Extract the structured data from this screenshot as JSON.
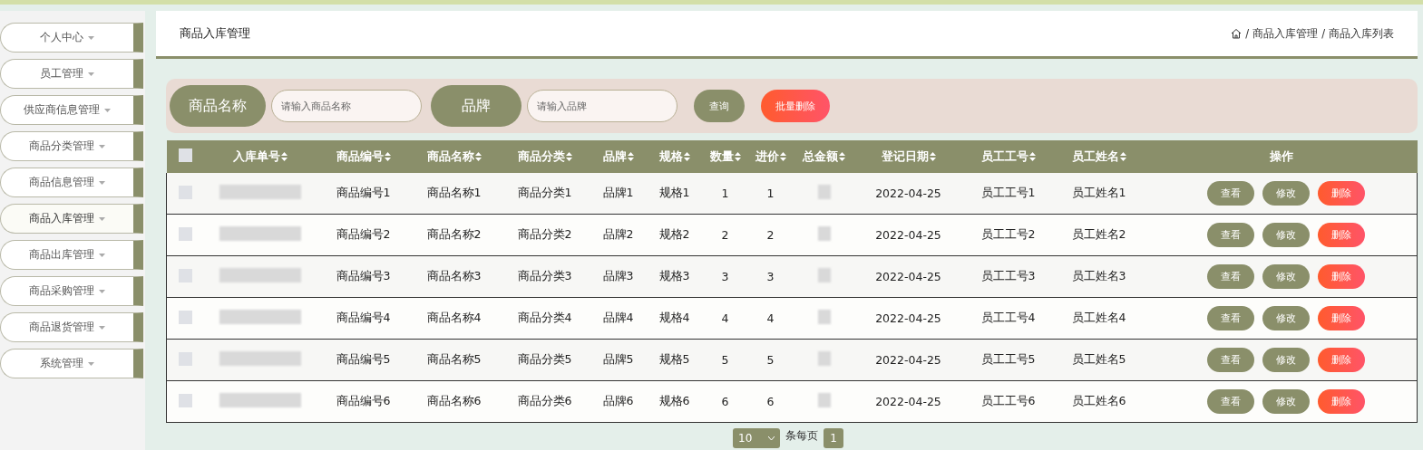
{
  "sidebar": {
    "items": [
      {
        "label": "个人中心",
        "selected": false
      },
      {
        "label": "员工管理",
        "selected": false
      },
      {
        "label": "供应商信息管理",
        "selected": false
      },
      {
        "label": "商品分类管理",
        "selected": false
      },
      {
        "label": "商品信息管理",
        "selected": false
      },
      {
        "label": "商品入库管理",
        "selected": true
      },
      {
        "label": "商品出库管理",
        "selected": false
      },
      {
        "label": "商品采购管理",
        "selected": false
      },
      {
        "label": "商品退货管理",
        "selected": false
      },
      {
        "label": "系统管理",
        "selected": false
      }
    ]
  },
  "header": {
    "title": "商品入库管理",
    "breadcrumb": [
      {
        "separator": "/",
        "label": "商品入库管理"
      },
      {
        "separator": "/",
        "label": "商品入库列表"
      }
    ]
  },
  "search": {
    "fields": [
      {
        "label": "商品名称",
        "placeholder": "请输入商品名称"
      },
      {
        "label": "品牌",
        "placeholder": "请输入品牌"
      }
    ],
    "query_button": "查询",
    "batch_delete_button": "批量删除"
  },
  "table": {
    "select_all_checked": false,
    "columns": [
      "入库单号",
      "商品编号",
      "商品名称",
      "商品分类",
      "品牌",
      "规格",
      "数量",
      "进价",
      "总金额",
      "登记日期",
      "员工工号",
      "员工姓名",
      "操作"
    ],
    "rows": [
      {
        "checked": false,
        "cells": [
          "",
          "商品编号1",
          "商品名称1",
          "商品分类1",
          "品牌1",
          "规格1",
          "1",
          "1",
          "",
          "2022-04-25",
          "员工工号1",
          "员工姓名1"
        ],
        "actions": [
          {
            "label": "查看",
            "kind": "neutral"
          },
          {
            "label": "修改",
            "kind": "neutral"
          },
          {
            "label": "删除",
            "kind": "danger"
          }
        ]
      },
      {
        "checked": false,
        "cells": [
          "",
          "商品编号2",
          "商品名称2",
          "商品分类2",
          "品牌2",
          "规格2",
          "2",
          "2",
          "",
          "2022-04-25",
          "员工工号2",
          "员工姓名2"
        ],
        "actions": [
          {
            "label": "查看",
            "kind": "neutral"
          },
          {
            "label": "修改",
            "kind": "neutral"
          },
          {
            "label": "删除",
            "kind": "danger"
          }
        ]
      },
      {
        "checked": false,
        "cells": [
          "",
          "商品编号3",
          "商品名称3",
          "商品分类3",
          "品牌3",
          "规格3",
          "3",
          "3",
          "",
          "2022-04-25",
          "员工工号3",
          "员工姓名3"
        ],
        "actions": [
          {
            "label": "查看",
            "kind": "neutral"
          },
          {
            "label": "修改",
            "kind": "neutral"
          },
          {
            "label": "删除",
            "kind": "danger"
          }
        ]
      },
      {
        "checked": false,
        "cells": [
          "",
          "商品编号4",
          "商品名称4",
          "商品分类4",
          "品牌4",
          "规格4",
          "4",
          "4",
          "",
          "2022-04-25",
          "员工工号4",
          "员工姓名4"
        ],
        "actions": [
          {
            "label": "查看",
            "kind": "neutral"
          },
          {
            "label": "修改",
            "kind": "neutral"
          },
          {
            "label": "删除",
            "kind": "danger"
          }
        ]
      },
      {
        "checked": false,
        "cells": [
          "",
          "商品编号5",
          "商品名称5",
          "商品分类5",
          "品牌5",
          "规格5",
          "5",
          "5",
          "",
          "2022-04-25",
          "员工工号5",
          "员工姓名5"
        ],
        "actions": [
          {
            "label": "查看",
            "kind": "neutral"
          },
          {
            "label": "修改",
            "kind": "neutral"
          },
          {
            "label": "删除",
            "kind": "danger"
          }
        ]
      },
      {
        "checked": false,
        "cells": [
          "",
          "商品编号6",
          "商品名称6",
          "商品分类6",
          "品牌6",
          "规格6",
          "6",
          "6",
          "",
          "2022-04-25",
          "员工工号6",
          "员工姓名6"
        ],
        "actions": [
          {
            "label": "查看",
            "kind": "neutral"
          },
          {
            "label": "修改",
            "kind": "neutral"
          },
          {
            "label": "删除",
            "kind": "danger"
          }
        ]
      }
    ]
  },
  "pagination": {
    "page_size": "10",
    "page_size_label": "条每页",
    "current_page": "1"
  }
}
